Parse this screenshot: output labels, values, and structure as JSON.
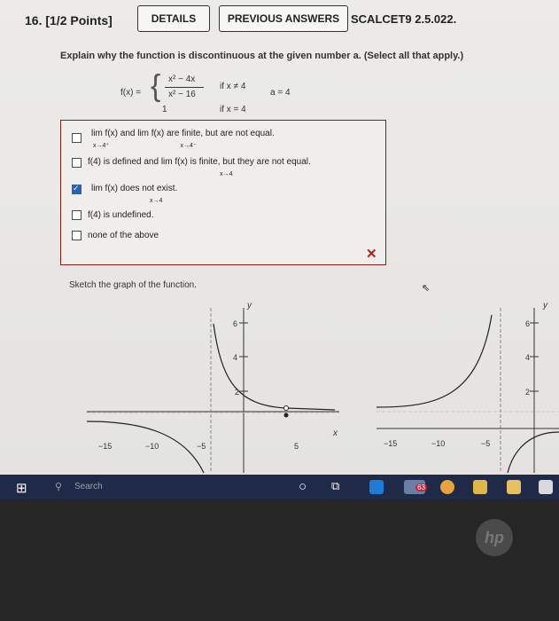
{
  "header": {
    "question": "16. [1/2 Points]",
    "details_label": "DETAILS",
    "previous_label": "PREVIOUS ANSWERS",
    "code": "SCALCET9 2.5.022."
  },
  "prompt": "Explain why the function is discontinuous at the given number a. (Select all that apply.)",
  "function": {
    "fx": "f(x) =",
    "num": "x² − 4x",
    "den": "x² − 16",
    "cond1": "if x ≠ 4",
    "val2": "1",
    "cond2": "if x = 4",
    "a": "a = 4"
  },
  "options": [
    {
      "text": "lim f(x) and lim f(x) are finite, but are not equal.",
      "sub1": "x→4⁺",
      "sub2": "x→4⁻",
      "checked": false
    },
    {
      "text": "f(4) is defined and lim f(x) is finite, but they are not equal.",
      "sub1": "x→4",
      "checked": false
    },
    {
      "text": "lim f(x) does not exist.",
      "sub1": "x→4",
      "checked": true
    },
    {
      "text": "f(4) is undefined.",
      "checked": false
    },
    {
      "text": "none of the above",
      "checked": false
    }
  ],
  "result_mark": "✕",
  "sketch_label": "Sketch the graph of the function.",
  "graphs": {
    "y_label": "y",
    "x_label": "x",
    "y_ticks": [
      "6",
      "4",
      "2"
    ],
    "x_ticks": [
      "−15",
      "−10",
      "−5",
      "5"
    ],
    "x_ticks_right": [
      "−15",
      "−10",
      "−5"
    ]
  },
  "taskbar": {
    "search_text": "Search",
    "badge": "63"
  },
  "brand": "hp"
}
